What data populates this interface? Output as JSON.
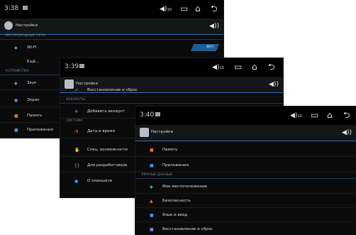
{
  "colors": {
    "accent": "#2f6fb0",
    "toggle_on": "#1d5d93",
    "background": "#0b0b0c"
  },
  "windows": [
    {
      "time": "3:38",
      "volume_level": "10",
      "title": "Настройки",
      "sections": [
        {
          "header": "БЕСПРОВОДНЫЕ СЕТИ",
          "items": [
            {
              "label": "Wi-Fi",
              "icon": "wifi-icon",
              "toggle": "ВКЛ"
            },
            {
              "label": "Ещё...",
              "icon": ""
            }
          ]
        },
        {
          "header": "УСТРОЙСТВО",
          "items": [
            {
              "label": "Звук",
              "icon": "sound-icon"
            },
            {
              "label": "Экран",
              "icon": "display-icon"
            },
            {
              "label": "Память",
              "icon": "storage-icon"
            },
            {
              "label": "Приложения",
              "icon": "apps-icon"
            }
          ]
        }
      ]
    },
    {
      "time": "3:39",
      "volume_level": "10",
      "title": "Настройки",
      "sections": [
        {
          "header": "",
          "items": [
            {
              "label": "Восстановление и сброс",
              "icon": "reset-icon"
            }
          ]
        },
        {
          "header": "АККАУНТЫ",
          "items": [
            {
              "label": "Добавить аккаунт",
              "icon": "add-icon"
            }
          ]
        },
        {
          "header": "СИСТЕМА",
          "items": [
            {
              "label": "Дата и время",
              "icon": "clock-icon"
            },
            {
              "label": "Спец. возможности",
              "icon": "accessibility-icon"
            },
            {
              "label": "Для разработчиков",
              "icon": "developer-icon"
            },
            {
              "label": "О планшете",
              "icon": "info-icon"
            }
          ]
        }
      ]
    },
    {
      "time": "3:40",
      "volume_level": "10",
      "title": "Настройки",
      "sections": [
        {
          "header": "",
          "items": [
            {
              "label": "Память",
              "icon": "storage-icon"
            },
            {
              "label": "Приложения",
              "icon": "apps-icon"
            }
          ]
        },
        {
          "header": "ЛИЧНЫЕ ДАННЫЕ",
          "items": [
            {
              "label": "Мое местоположение",
              "icon": "location-icon"
            },
            {
              "label": "Безопасность",
              "icon": "lock-icon"
            },
            {
              "label": "Язык и ввод",
              "icon": "language-icon"
            },
            {
              "label": "Восстановление и сброс",
              "icon": "reset-icon"
            }
          ]
        }
      ]
    }
  ]
}
